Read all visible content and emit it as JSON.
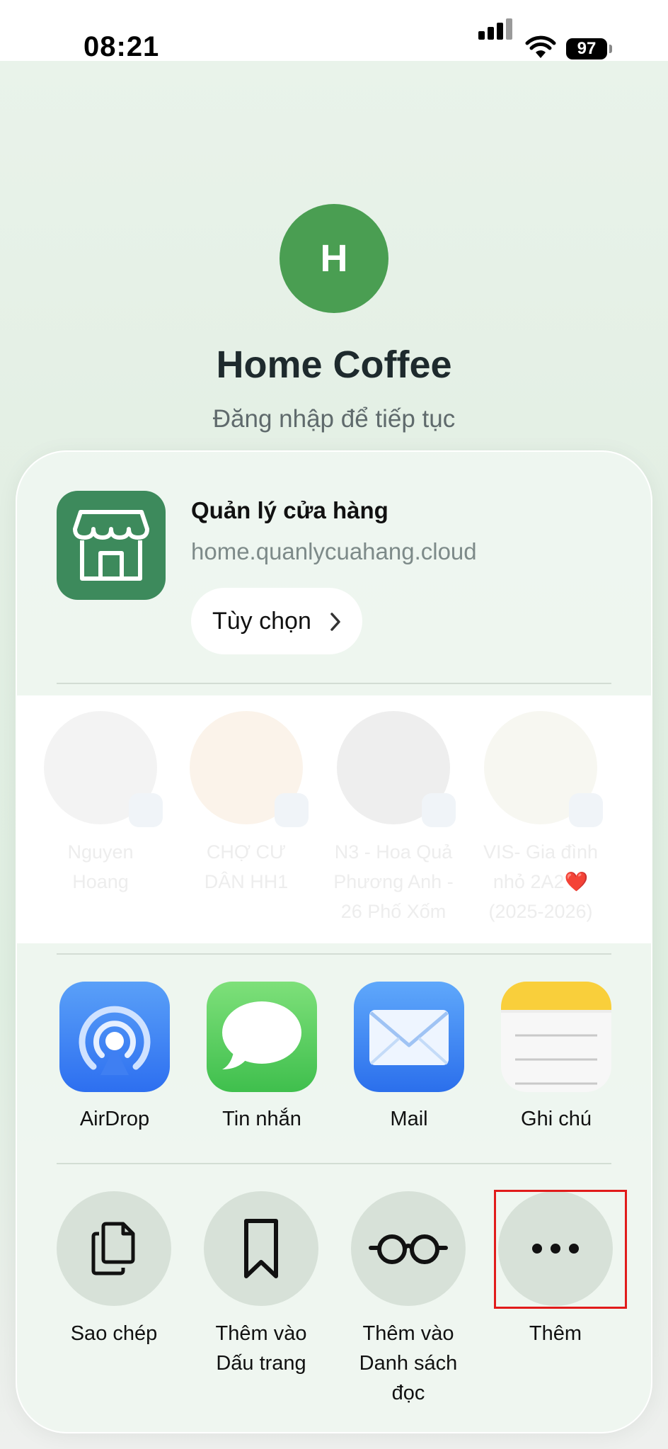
{
  "status_bar": {
    "time": "08:21",
    "battery": "97"
  },
  "login": {
    "avatar_letter": "H",
    "brand_name": "Home Coffee",
    "tagline": "Đăng nhập để tiếp tục"
  },
  "share_sheet": {
    "site_title": "Quản lý cửa hàng",
    "site_url": "home.quanlycuahang.cloud",
    "options_label": "Tùy chọn",
    "contacts": [
      {
        "name_line1": "Nguyen",
        "name_line2": "Hoang",
        "name_line3": ""
      },
      {
        "name_line1": "CHỢ CƯ",
        "name_line2": "DÂN HH1",
        "name_line3": ""
      },
      {
        "name_line1": "N3 - Hoa Quả",
        "name_line2": "Phương Anh -",
        "name_line3": "26 Phố Xốm"
      },
      {
        "name_line1": "VIS- Gia đình",
        "name_line2": "nhỏ 2A2❤️",
        "name_line3": "(2025-2026)"
      }
    ],
    "apps": [
      {
        "label": "AirDrop"
      },
      {
        "label": "Tin nhắn"
      },
      {
        "label": "Mail"
      },
      {
        "label": "Ghi chú"
      }
    ],
    "actions": [
      {
        "line1": "Sao chép",
        "line2": "",
        "line3": ""
      },
      {
        "line1": "Thêm vào",
        "line2": "Dấu trang",
        "line3": ""
      },
      {
        "line1": "Thêm vào",
        "line2": "Danh sách",
        "line3": "đọc"
      },
      {
        "line1": "Thêm",
        "line2": "",
        "line3": ""
      }
    ],
    "highlight_color": "#e11b1b"
  }
}
